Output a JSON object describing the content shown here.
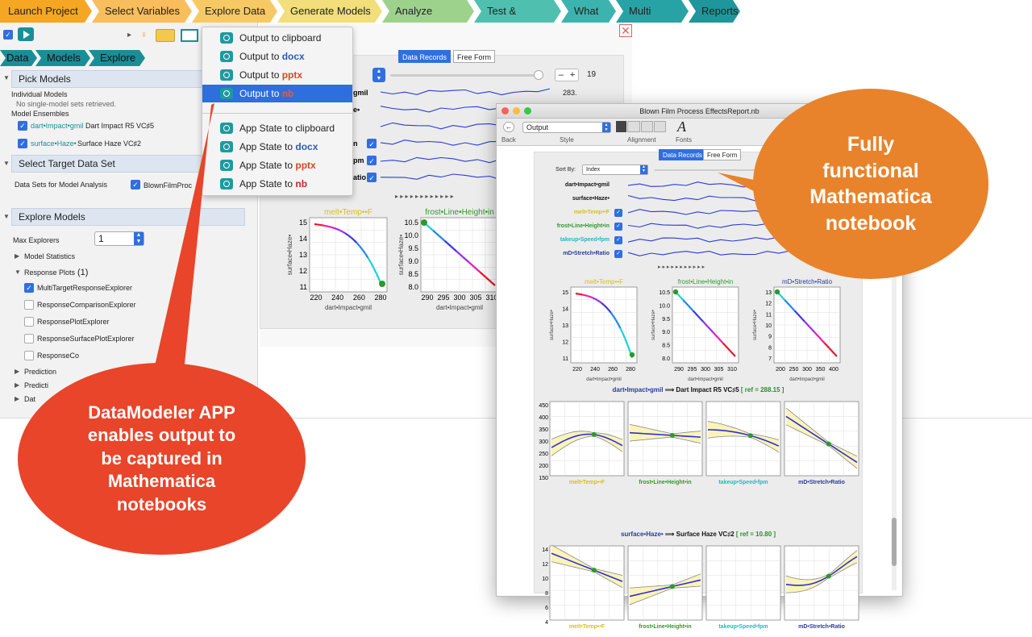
{
  "workflow": {
    "steps": [
      {
        "label": "Launch Project",
        "color": "#f5a623"
      },
      {
        "label": "Select Variables",
        "color": "#f8bd5c"
      },
      {
        "label": "Explore Data",
        "color": "#f7c964"
      },
      {
        "label": "Generate Models",
        "color": "#f2de7a"
      },
      {
        "label": "Analyze Models",
        "color": "#9dd28c"
      },
      {
        "label": "Test & Validate",
        "color": "#4fc0b0"
      },
      {
        "label": "What If?",
        "color": "#3db3b0"
      },
      {
        "label": "Multi Target",
        "color": "#27a3a6"
      },
      {
        "label": "Reports",
        "color": "#1e969b"
      }
    ]
  },
  "breadcrumb": [
    "Data",
    "Models",
    "Explore"
  ],
  "pick_models": {
    "title": "Pick Models",
    "individual_label": "Individual Models",
    "individual_note": "No single-model sets retrieved.",
    "ensembles_label": "Model Ensembles",
    "ensembles": [
      {
        "var": "dart•Impact•gmil",
        "name": "Dart Impact R5 VC♯5"
      },
      {
        "var": "surface•Haze•",
        "name": "Surface Haze VC♯2"
      }
    ]
  },
  "target": {
    "title": "Select Target Data Set",
    "label": "Data Sets for Model Analysis",
    "value": "BlownFilmProc"
  },
  "explore": {
    "title": "Explore Models",
    "max_label": "Max Explorers",
    "max_value": "1",
    "model_stats": "Model Statistics",
    "response_plots": "Response Plots",
    "response_count": "(1)",
    "options": [
      {
        "label": "MultiTargetResponseExplorer",
        "checked": true
      },
      {
        "label": "ResponseComparisonExplorer",
        "checked": false
      },
      {
        "label": "ResponsePlotExplorer",
        "checked": false
      },
      {
        "label": "ResponseSurfacePlotExplorer",
        "checked": false
      },
      {
        "label": "ResponseCo",
        "checked": false
      }
    ],
    "more": [
      "Prediction",
      "Predicti",
      "Dat"
    ]
  },
  "menu": {
    "items": [
      {
        "prefix": "Output to ",
        "fmt": "clipboard",
        "cls": ""
      },
      {
        "prefix": "Output to ",
        "fmt": "docx",
        "cls": "fmt-docx"
      },
      {
        "prefix": "Output to ",
        "fmt": "pptx",
        "cls": "fmt-pptx"
      },
      {
        "prefix": "Output to ",
        "fmt": "nb",
        "cls": "fmt-nb",
        "highlight": true
      },
      {
        "prefix": "App State to ",
        "fmt": "clipboard",
        "cls": ""
      },
      {
        "prefix": "App State to ",
        "fmt": "docx",
        "cls": "fmt-docx"
      },
      {
        "prefix": "App State to ",
        "fmt": "pptx",
        "cls": "fmt-pptx"
      },
      {
        "prefix": "App State to ",
        "fmt": "nb",
        "cls": "fmt-nb"
      }
    ]
  },
  "bg_explorer": {
    "tabs": [
      "Data Records",
      "Free Form"
    ],
    "slider_value": "19",
    "minus": "–",
    "plus": "+",
    "row_values": [
      "283."
    ],
    "row_labels": [
      "gmil",
      "e•",
      "",
      "n",
      "pm",
      "atio"
    ],
    "plot1": {
      "title": "melt•Temp••F",
      "xlabel": "dart•Impact•gmil",
      "ylabel": "surface•Haze•",
      "xticks": [
        "220",
        "240",
        "260",
        "280"
      ],
      "yticks": [
        "15",
        "14",
        "13",
        "12",
        "11"
      ]
    },
    "plot2": {
      "title": "frost•Line•Height•in",
      "xlabel": "dart•Impact•gmil",
      "ylabel": "surface•Haze•",
      "xticks": [
        "290",
        "295",
        "300",
        "305",
        "310"
      ],
      "yticks": [
        "10.5",
        "10.0",
        "9.5",
        "9.0",
        "8.5",
        "8.0"
      ]
    }
  },
  "notebook": {
    "title": "Blown Film Process EffectsReport.nb",
    "style_value": "Output",
    "toolbar_labels": [
      "Back",
      "Style",
      "Alignment",
      "Fonts"
    ],
    "tabs": [
      "Data Records",
      "Free Form"
    ],
    "sort_label": "Sort By:",
    "sort_value": "Index",
    "rows": [
      {
        "label": "dart•Impact•gmil",
        "color": "#111",
        "checked": false
      },
      {
        "label": "surface•Haze•",
        "color": "#111",
        "checked": false
      },
      {
        "label": "melt•Temp••F",
        "color": "#d4c21b",
        "checked": true
      },
      {
        "label": "frost•Line•Height•in",
        "color": "#2e9a2e",
        "checked": true
      },
      {
        "label": "takeup•Speed•fpm",
        "color": "#25b5c9",
        "checked": true
      },
      {
        "label": "mD•Stretch•Ratio",
        "color": "#2a3b9e",
        "checked": true
      }
    ],
    "scatter": [
      {
        "title": "melt•Temp••F",
        "color": "#d4c21b",
        "xticks": [
          "220",
          "240",
          "260",
          "280"
        ],
        "yticks": [
          "15",
          "14",
          "13",
          "12",
          "11"
        ],
        "xlabel": "dart•Impact•gmil",
        "ylabel": "surface•Haze•"
      },
      {
        "title": "frost•Line•Height•in",
        "color": "#2e9a2e",
        "xticks": [
          "290",
          "295",
          "300",
          "305",
          "310"
        ],
        "yticks": [
          "10.5",
          "10.0",
          "9.5",
          "9.0",
          "8.5",
          "8.0"
        ],
        "xlabel": "dart•Impact•gmil",
        "ylabel": "surface•Haze•"
      },
      {
        "title": "mD•Stretch•Ratio",
        "color": "#2a3b9e",
        "xticks": [
          "200",
          "250",
          "300",
          "350",
          "400"
        ],
        "yticks": [
          "13",
          "12",
          "11",
          "10",
          "9",
          "8",
          "7"
        ],
        "xlabel": "dart•Impact•gmil",
        "ylabel": "surface•Haze•"
      }
    ],
    "heading1": {
      "var": "dart•Impact•gmil",
      "arrow": "⟹",
      "name": "Dart Impact R5 VC♯5",
      "ref": "[ ref = 288.15 ]"
    },
    "heading2": {
      "var": "surface•Haze•",
      "arrow": "⟹",
      "name": "Surface Haze VC♯2",
      "ref": "[ ref = 10.80 ]"
    },
    "resp1_yticks": [
      "450",
      "400",
      "350",
      "300",
      "250",
      "200",
      "150"
    ],
    "resp2_yticks": [
      "14",
      "12",
      "10",
      "8",
      "6",
      "4"
    ],
    "factors": [
      {
        "label": "melt•Temp••F",
        "color": "#d4c21b"
      },
      {
        "label": "frost•Line•Height•in",
        "color": "#2e9a2e"
      },
      {
        "label": "takeup•Speed•fpm",
        "color": "#25b5c9"
      },
      {
        "label": "mD•Stretch•Ratio",
        "color": "#2a3b9e"
      }
    ]
  },
  "callouts": {
    "left": [
      "DataModeler APP",
      "enables output to",
      "be captured in",
      "Mathematica",
      "notebooks"
    ],
    "right": [
      "Fully",
      "functional",
      "Mathematica",
      "notebook"
    ]
  },
  "colors": {
    "accent": "#2f6fe0",
    "teal": "#1a8e97",
    "left_callout": "#e8452a",
    "right_callout": "#e8832b"
  }
}
